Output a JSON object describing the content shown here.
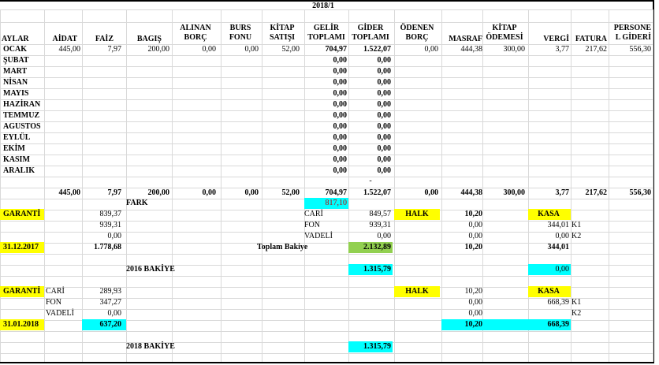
{
  "sheet_title": "2018/1",
  "headers": {
    "aylar": "AYLAR",
    "aidat": "AİDAT",
    "faiz": "FAİZ",
    "bagis": "BAGIŞ",
    "alinan_borc_1": "ALINAN",
    "alinan_borc_2": "BORÇ",
    "burs_1": "BURS",
    "burs_2": "FONU",
    "kitap_satisi_1": "KİTAP",
    "kitap_satisi_2": "SATIŞI",
    "gelir_1": "GELİR",
    "gelir_2": "TOPLAMI",
    "gider_1": "GİDER",
    "gider_2": "TOPLAMI",
    "odenen_1": "ÖDENEN",
    "odenen_2": "BORÇ",
    "masraf": "MASRAF",
    "kitap_odemesi_1": "KİTAP",
    "kitap_odemesi_2": "ÖDEMESİ",
    "vergi": "VERGİ",
    "fatura": "FATURA",
    "personel_1": "PERSONE",
    "personel_2": "L GİDERİ"
  },
  "months": [
    {
      "name": "OCAK",
      "aidat": "445,00",
      "faiz": "7,97",
      "bagis": "200,00",
      "alinan": "0,00",
      "burs": "0,00",
      "kitap": "52,00",
      "gelir": "704,97",
      "gider": "1.522,07",
      "odenen": "0,00",
      "masraf": "444,38",
      "kitap_odeme": "300,00",
      "vergi": "3,77",
      "fatura": "217,62",
      "personel": "556,30"
    },
    {
      "name": "ŞUBAT",
      "gelir": "0,00",
      "gider": "0,00"
    },
    {
      "name": "MART",
      "gelir": "0,00",
      "gider": "0,00"
    },
    {
      "name": "NİSAN",
      "gelir": "0,00",
      "gider": "0,00"
    },
    {
      "name": "MAYIS",
      "gelir": "0,00",
      "gider": "0,00"
    },
    {
      "name": "HAZİRAN",
      "gelir": "0,00",
      "gider": "0,00"
    },
    {
      "name": "TEMMUZ",
      "gelir": "0,00",
      "gider": "0,00"
    },
    {
      "name": "AGUSTOS",
      "gelir": "0,00",
      "gider": "0,00"
    },
    {
      "name": "EYLÜL",
      "gelir": "0,00",
      "gider": "0,00"
    },
    {
      "name": "EKİM",
      "gelir": "0,00",
      "gider": "0,00"
    },
    {
      "name": "KASIM",
      "gelir": "0,00",
      "gider": "0,00"
    },
    {
      "name": "ARALIK",
      "gelir": "0,00",
      "gider": "0,00"
    }
  ],
  "dash": "-",
  "totals": {
    "aidat": "445,00",
    "faiz": "7,97",
    "bagis": "200,00",
    "alinan": "0,00",
    "burs": "0,00",
    "kitap": "52,00",
    "gelir": "704,97",
    "gider": "1.522,07",
    "odenen": "0,00",
    "masraf": "444,38",
    "kitap_odeme": "300,00",
    "vergi": "3,77",
    "fatura": "217,62",
    "personel": "556,30"
  },
  "fark": {
    "label": "FARK",
    "value": "817,10"
  },
  "block1": {
    "garanti": "GARANTİ",
    "garanti_values": [
      "839,37",
      "939,31",
      "0,00"
    ],
    "date": "31.12.2017",
    "garanti_total": "1.778,68",
    "toplam_label": "Toplam Bakiye",
    "toplam_value": "2.132,89",
    "accounts": [
      "CARİ",
      "FON",
      "VADELİ"
    ],
    "acc_values": [
      "849,57",
      "939,31",
      "0,00"
    ],
    "halk": "HALK",
    "halk_values": [
      "10,20",
      "0,00",
      "0,00"
    ],
    "halk_total": "10,20",
    "kasa": "KASA",
    "kasa_values": [
      "344,01",
      "0,00"
    ],
    "kasa_total": "344,01",
    "k_labels": [
      "K1",
      "K2"
    ],
    "bakiye_label": "2016 BAKİYE",
    "bakiye_value": "1.315,79",
    "kasa_bakiye": "0,00"
  },
  "block2": {
    "garanti": "GARANTİ",
    "accounts": [
      "CARİ",
      "FON",
      "VADELİ"
    ],
    "acc_values": [
      "289,93",
      "347,27",
      "0,00"
    ],
    "date": "31.01.2018",
    "garanti_total": "637,20",
    "halk": "HALK",
    "halk_values": [
      "10,20",
      "0,00",
      "0,00"
    ],
    "halk_total": "10,20",
    "kasa": "KASA",
    "kasa_values": [
      "668,39"
    ],
    "kasa_total": "668,39",
    "k_labels": [
      "K1",
      "K2"
    ],
    "bakiye_label": "2018 BAKİYE",
    "bakiye_value": "1.315,79"
  },
  "colors": {
    "yellow": "#ffff00",
    "cyan": "#00ffff",
    "green": "#92d050",
    "red": "#c00000",
    "grid": "#d9d9d9"
  }
}
